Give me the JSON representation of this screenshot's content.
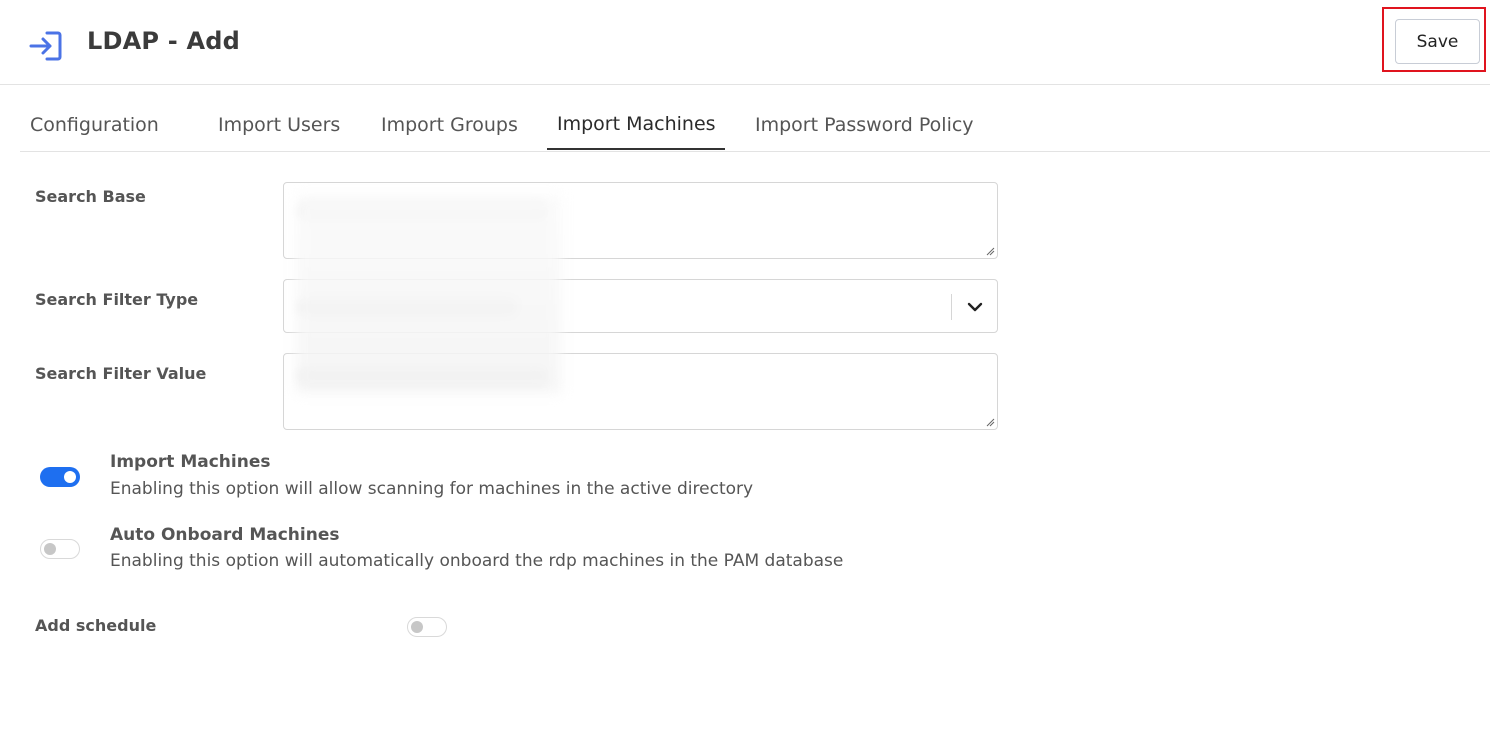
{
  "header": {
    "title": "LDAP - Add",
    "icon": "login-icon",
    "save_label": "Save"
  },
  "tabs": [
    {
      "label": "Configuration",
      "active": false
    },
    {
      "label": "Import Users",
      "active": false
    },
    {
      "label": "Import Groups",
      "active": false
    },
    {
      "label": "Import Machines",
      "active": true
    },
    {
      "label": "Import Password Policy",
      "active": false
    }
  ],
  "form": {
    "search_base": {
      "label": "Search Base"
    },
    "search_filter_type": {
      "label": "Search Filter Type"
    },
    "search_filter_value": {
      "label": "Search Filter Value"
    }
  },
  "options": {
    "import_machines": {
      "title": "Import Machines",
      "description": "Enabling this option will allow scanning for machines in the active directory",
      "enabled": true
    },
    "auto_onboard": {
      "title": "Auto Onboard Machines",
      "description": "Enabling this option will automatically onboard the rdp machines in the PAM database",
      "enabled": false
    }
  },
  "schedule": {
    "label": "Add schedule",
    "enabled": false
  },
  "colors": {
    "accent": "#1e6ff0",
    "icon": "#4b73e6",
    "highlight": "#e0141e"
  }
}
